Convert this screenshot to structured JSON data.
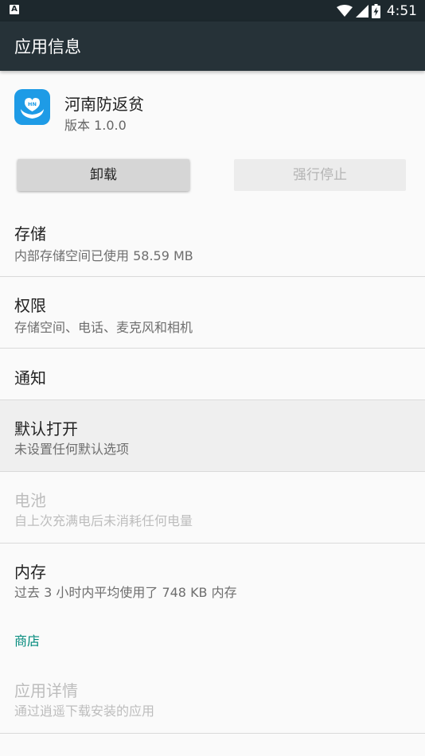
{
  "status_bar": {
    "notification_icon": "a-notification-icon",
    "time": "4:51",
    "icons": [
      "wifi-icon",
      "signal-icon",
      "battery-charging-icon"
    ]
  },
  "app_bar": {
    "title": "应用信息"
  },
  "app": {
    "name": "河南防返贫",
    "version": "版本 1.0.0",
    "icon_color": "#1e9be6"
  },
  "buttons": {
    "uninstall": "卸载",
    "force_stop": "强行停止"
  },
  "items": [
    {
      "title": "存储",
      "subtitle": "内部存储空间已使用 58.59 MB",
      "enabled": true
    },
    {
      "title": "权限",
      "subtitle": "存储空间、电话、麦克风和相机",
      "enabled": true
    },
    {
      "title": "通知",
      "subtitle": "",
      "enabled": true
    },
    {
      "title": "默认打开",
      "subtitle": "未设置任何默认选项",
      "enabled": true,
      "highlighted": true
    },
    {
      "title": "电池",
      "subtitle": "自上次充满电后未消耗任何电量",
      "enabled": false
    },
    {
      "title": "内存",
      "subtitle": "过去 3 小时内平均使用了 748 KB 内存",
      "enabled": true
    }
  ],
  "store_section": {
    "label": "商店"
  },
  "store_item": {
    "title": "应用详情",
    "subtitle": "通过逍遥下载安装的应用",
    "enabled": false
  },
  "colors": {
    "app_bar": "#263238",
    "status_bar": "#1d282d",
    "accent": "#00897b"
  }
}
